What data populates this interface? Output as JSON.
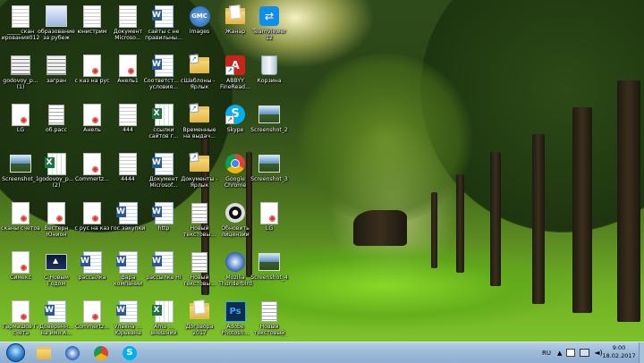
{
  "desktop": {
    "columns": [
      [
        {
          "label": "_____скан ирования012 6_рус+",
          "kind": "doc"
        },
        {
          "label": "godovoy_p... (1)",
          "kind": "thumb-gray"
        },
        {
          "label": "LG",
          "kind": "pdf"
        },
        {
          "label": "Screenshot_1",
          "kind": "shot"
        },
        {
          "label": "сканы счетов",
          "kind": "pdf"
        },
        {
          "label": "Симекс",
          "kind": "pdf"
        },
        {
          "label": "Гармашов Г. счета",
          "kind": "pdf"
        }
      ],
      [
        {
          "label": "образование за рубеж",
          "kind": "img"
        },
        {
          "label": "загран",
          "kind": "thumb-gray"
        },
        {
          "label": "об.расс",
          "kind": "txt"
        },
        {
          "label": "godovoy_p... (2)",
          "kind": "excel"
        },
        {
          "label": "Вестерн Юнион",
          "kind": "pdf"
        },
        {
          "label": "С Новым Годом",
          "kind": "thumb-dark"
        },
        {
          "label": "Доверенн... на имя А...",
          "kind": "word"
        }
      ],
      [
        {
          "label": "юнистрим",
          "kind": "doc"
        },
        {
          "label": "с каз на рус",
          "kind": "pdf"
        },
        {
          "label": "Анель",
          "kind": "pdf"
        },
        {
          "label": "Commertz...",
          "kind": "pdf"
        },
        {
          "label": "с рус на каз",
          "kind": "pdf"
        },
        {
          "label": "рассылка",
          "kind": "word"
        },
        {
          "label": "Commertz...",
          "kind": "pdf"
        }
      ],
      [
        {
          "label": "Документ Microso...",
          "kind": "doc"
        },
        {
          "label": "Анель1",
          "kind": "pdf"
        },
        {
          "label": "444",
          "kind": "doc"
        },
        {
          "label": "4444",
          "kind": "doc"
        },
        {
          "label": "гос.закупки",
          "kind": "word"
        },
        {
          "label": "фара компании",
          "kind": "word"
        },
        {
          "label": "Ульяна ... Юрьевна",
          "kind": "word"
        }
      ],
      [
        {
          "label": "сайты с не правильны...",
          "kind": "word"
        },
        {
          "label": "Соответст... с условия...",
          "kind": "word"
        },
        {
          "label": "ссылки сайтов г...",
          "kind": "excel"
        },
        {
          "label": "Документ Microsof...",
          "kind": "word"
        },
        {
          "label": "http",
          "kind": "word"
        },
        {
          "label": "рассылка НI",
          "kind": "word"
        },
        {
          "label": "Ama ... внешний",
          "kind": "excel"
        }
      ],
      [
        {
          "label": "images",
          "kind": "gmc"
        },
        {
          "label": "Шаблоны - Ярлык",
          "kind": "folder-shortcut"
        },
        {
          "label": "Временные на выдач...",
          "kind": "folder-shortcut"
        },
        {
          "label": "Документы - Ярлык",
          "kind": "folder-shortcut"
        },
        {
          "label": "Новый текстовы...",
          "kind": "txt"
        },
        {
          "label": "Новый текстовы...",
          "kind": "txt"
        },
        {
          "label": "Договора 2017",
          "kind": "folder"
        }
      ],
      [
        {
          "label": "Жанар",
          "kind": "folder"
        },
        {
          "label": "ABBYY FineRead...",
          "kind": "abbyy"
        },
        {
          "label": "Skype",
          "kind": "skype"
        },
        {
          "label": "Google Chrome",
          "kind": "chrome"
        },
        {
          "label": "Обновить лицензии",
          "kind": "updater"
        },
        {
          "label": "Mozilla Thunderbird",
          "kind": "thunder"
        },
        {
          "label": "Adobe Photosh...",
          "kind": "ps"
        }
      ],
      [
        {
          "label": "TeamViewer 12",
          "kind": "teamviewer"
        },
        {
          "label": "Корзина",
          "kind": "bin"
        },
        {
          "label": "Screenshot_2",
          "kind": "shot"
        },
        {
          "label": "Screenshot_3",
          "kind": "shot"
        },
        {
          "label": "LG",
          "kind": "pdf"
        },
        {
          "label": "Screenshot_4",
          "kind": "shot"
        },
        {
          "label": "Новый текстовый документ (3)",
          "kind": "txt"
        }
      ]
    ]
  },
  "taskbar": {
    "pinned": [
      {
        "name": "explorer",
        "icon": "folder-icon"
      },
      {
        "name": "thunderbird",
        "icon": "thunderbird-icon"
      },
      {
        "name": "chrome",
        "icon": "chrome-icon"
      },
      {
        "name": "skype",
        "icon": "skype-icon"
      }
    ],
    "tray": {
      "language": "RU",
      "time": "9:00",
      "date": "18.02.2017"
    }
  },
  "colors": {
    "taskbar": "#9fbcd9",
    "accent": "#2f7fd0"
  }
}
